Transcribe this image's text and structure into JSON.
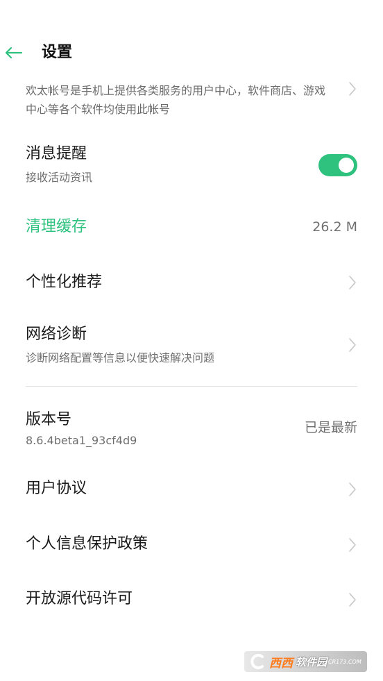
{
  "header": {
    "title": "设置",
    "back_icon": "arrow-left-icon",
    "accent_color": "#2ec27e"
  },
  "account": {
    "description": "欢太帐号是手机上提供各类服务的用户中心，软件商店、游戏中心等各个软件均使用此帐号"
  },
  "notifications": {
    "title": "消息提醒",
    "subtitle": "接收活动资讯",
    "toggle_on": true
  },
  "cache": {
    "title": "清理缓存",
    "size": "26.2 M"
  },
  "personalized": {
    "title": "个性化推荐"
  },
  "network": {
    "title": "网络诊断",
    "subtitle": "诊断网络配置等信息以便快速解决问题"
  },
  "version": {
    "title": "版本号",
    "number": "8.6.4beta1_93cf4d9",
    "status": "已是最新"
  },
  "user_agreement": {
    "title": "用户协议"
  },
  "privacy": {
    "title": "个人信息保护政策"
  },
  "open_source": {
    "title": "开放源代码许可"
  },
  "watermark": {
    "brand_cn": "西西",
    "brand_text": "软件园",
    "domain": "CR173.COM"
  }
}
